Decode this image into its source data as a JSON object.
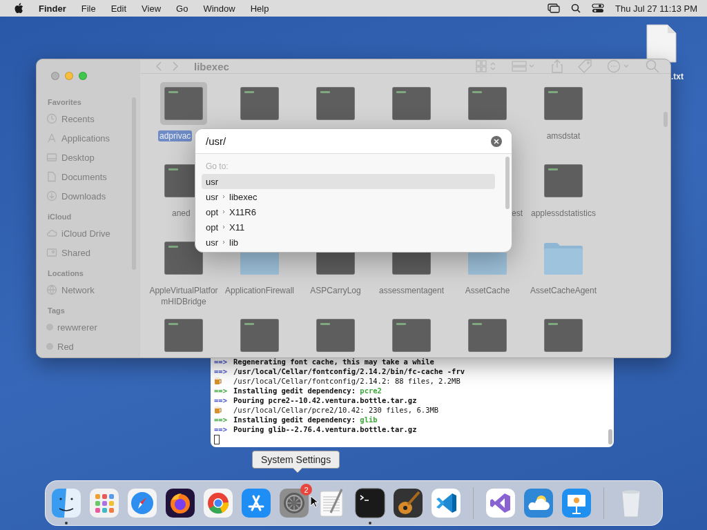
{
  "menubar": {
    "app": "Finder",
    "menus": [
      "File",
      "Edit",
      "View",
      "Go",
      "Window",
      "Help"
    ],
    "clock": "Thu Jul 27  11:13 PM"
  },
  "desktop_file": {
    "label": ".txt"
  },
  "finder": {
    "title": "libexec",
    "sidebar": [
      {
        "heading": "Favorites",
        "items": [
          {
            "label": "Recents",
            "kind": "clock"
          },
          {
            "label": "Applications",
            "kind": "apps"
          },
          {
            "label": "Desktop",
            "kind": "desktop"
          },
          {
            "label": "Documents",
            "kind": "doc"
          },
          {
            "label": "Downloads",
            "kind": "download"
          }
        ]
      },
      {
        "heading": "iCloud",
        "items": [
          {
            "label": "iCloud Drive",
            "kind": "cloud"
          },
          {
            "label": "Shared",
            "kind": "shared"
          }
        ]
      },
      {
        "heading": "Locations",
        "items": [
          {
            "label": "Network",
            "kind": "network"
          }
        ]
      },
      {
        "heading": "Tags",
        "items": [
          {
            "label": "rewwrerer",
            "kind": "tag"
          },
          {
            "label": "Red",
            "kind": "tag"
          }
        ]
      }
    ],
    "files": [
      {
        "label": "adprivac",
        "kind": "exec",
        "selected": true,
        "clipped_end": true
      },
      {
        "kind": "exec",
        "selected": false
      },
      {
        "kind": "exec",
        "selected": false
      },
      {
        "kind": "exec",
        "selected": false
      },
      {
        "kind": "exec",
        "selected": false
      },
      {
        "label": "amsdstat",
        "kind": "exec",
        "selected": false
      },
      {
        "label": "aned",
        "kind": "exec",
        "selected": false,
        "clipped_end": true
      },
      {
        "kind": "covered"
      },
      {
        "kind": "covered"
      },
      {
        "kind": "covered"
      },
      {
        "label": "est",
        "kind": "covered",
        "selected": false,
        "clipped_start": true
      },
      {
        "label": "applessdstatistics",
        "kind": "exec",
        "selected": false
      },
      {
        "label": "AppleVirtualPlatformHIDBridge",
        "kind": "exec",
        "selected": false
      },
      {
        "label": "ApplicationFirewall",
        "kind": "folder",
        "selected": false
      },
      {
        "label": "ASPCarryLog",
        "kind": "exec",
        "selected": false
      },
      {
        "label": "assessmentagent",
        "kind": "exec",
        "selected": false
      },
      {
        "label": "AssetCache",
        "kind": "folder",
        "selected": false
      },
      {
        "label": "AssetCacheAgent",
        "kind": "folder",
        "selected": false
      },
      {
        "kind": "exec",
        "selected": false
      },
      {
        "kind": "exec",
        "selected": false
      },
      {
        "kind": "exec",
        "selected": false
      },
      {
        "kind": "exec",
        "selected": false
      },
      {
        "kind": "exec",
        "selected": false
      },
      {
        "kind": "exec",
        "selected": false
      }
    ]
  },
  "terminal": {
    "lines": [
      {
        "kind": "step",
        "prefix": "==>",
        "text": "Regenerating font cache, this may take a while"
      },
      {
        "kind": "step",
        "prefix": "==>",
        "text": "/usr/local/Cellar/fontconfig/2.14.2/bin/fc-cache -frv"
      },
      {
        "kind": "summary",
        "text": "/usr/local/Cellar/fontconfig/2.14.2: 88 files, 2.2MB"
      },
      {
        "kind": "install",
        "prefix": "==>",
        "text": "Installing gedit dependency: ",
        "highlight": "pcre2"
      },
      {
        "kind": "step",
        "prefix": "==>",
        "text": "Pouring pcre2--10.42.ventura.bottle.tar.gz"
      },
      {
        "kind": "summary",
        "text": "/usr/local/Cellar/pcre2/10.42: 230 files, 6.3MB"
      },
      {
        "kind": "install",
        "prefix": "==>",
        "text": "Installing gedit dependency: ",
        "highlight": "glib"
      },
      {
        "kind": "step",
        "prefix": "==>",
        "text": "Pouring glib--2.76.4.ventura.bottle.tar.gz"
      }
    ]
  },
  "goto_dialog": {
    "value": "/usr/",
    "heading": "Go to:",
    "suggestions": [
      {
        "parts": [
          "usr"
        ],
        "selected": true
      },
      {
        "parts": [
          "usr",
          "libexec"
        ],
        "selected": false
      },
      {
        "parts": [
          "opt",
          "X11R6"
        ],
        "selected": false
      },
      {
        "parts": [
          "opt",
          "X11"
        ],
        "selected": false
      },
      {
        "parts": [
          "usr",
          "lib"
        ],
        "selected": false
      }
    ]
  },
  "tooltip": "System Settings",
  "dock": [
    {
      "kind": "finder",
      "running": true
    },
    {
      "kind": "launchpad",
      "running": false
    },
    {
      "kind": "safari",
      "running": false
    },
    {
      "kind": "firefox",
      "running": false
    },
    {
      "kind": "chrome",
      "running": false
    },
    {
      "kind": "appstore",
      "running": false
    },
    {
      "kind": "settings",
      "running": false,
      "badge": "2"
    },
    {
      "kind": "textedit",
      "running": false
    },
    {
      "kind": "terminal",
      "running": true
    },
    {
      "kind": "garageband",
      "running": false
    },
    {
      "kind": "vscode",
      "running": false
    },
    {
      "kind": "separator"
    },
    {
      "kind": "visualstudio",
      "running": false
    },
    {
      "kind": "weather",
      "running": false
    },
    {
      "kind": "keynote",
      "running": false
    },
    {
      "kind": "separator"
    },
    {
      "kind": "trash",
      "running": false
    }
  ]
}
